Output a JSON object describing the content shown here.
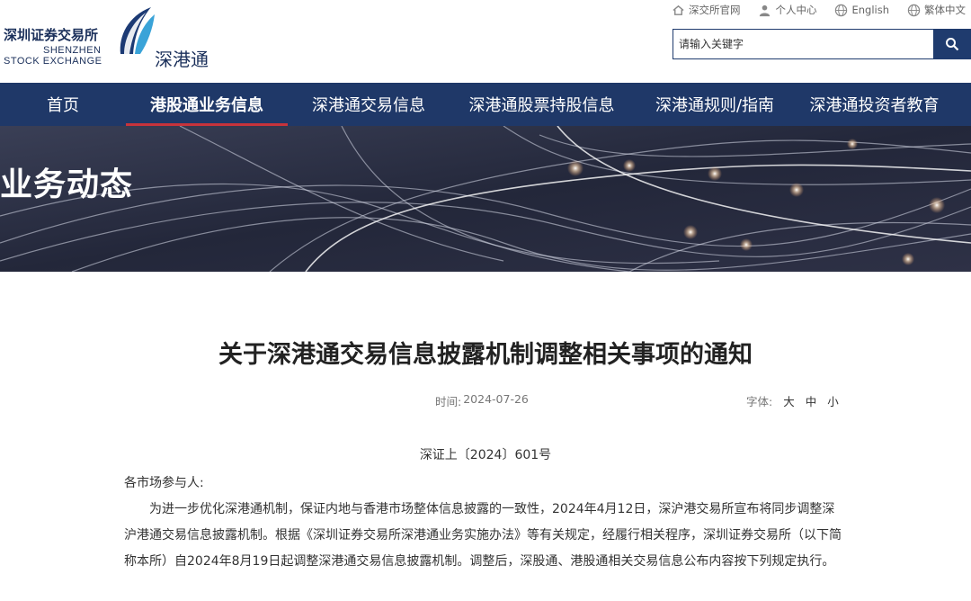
{
  "header": {
    "logo_cn": "深圳证券交易所",
    "logo_en_line1": "SHENZHEN",
    "logo_en_line2": "STOCK EXCHANGE",
    "logo_sub": "深港通",
    "top_links": [
      {
        "label": "深交所官网",
        "icon": "home-icon"
      },
      {
        "label": "个人中心",
        "icon": "user-icon"
      },
      {
        "label": "English",
        "icon": "globe-icon"
      },
      {
        "label": "繁体中文",
        "icon": "globe-icon"
      }
    ],
    "search": {
      "placeholder": "请输入关键字",
      "button_icon": "search-icon"
    }
  },
  "nav": {
    "items": [
      {
        "label": "首页",
        "active": false
      },
      {
        "label": "港股通业务信息",
        "active": true
      },
      {
        "label": "深港通交易信息",
        "active": false
      },
      {
        "label": "深港通股票持股信息",
        "active": false
      },
      {
        "label": "深港通规则/指南",
        "active": false
      },
      {
        "label": "深港通投资者教育",
        "active": false
      }
    ]
  },
  "banner": {
    "title": "业务动态"
  },
  "article": {
    "title": "关于深港通交易信息披露机制调整相关事项的通知",
    "time_label": "时间:",
    "time_value": "2024-07-26",
    "font_label": "字体:",
    "font_sizes": [
      "大",
      "中",
      "小"
    ],
    "doc_no": "深证上〔2024〕601号",
    "salutation": "各市场参与人:",
    "paragraph": "为进一步优化深港通机制，保证内地与香港市场整体信息披露的一致性，2024年4月12日，深沪港交易所宣布将同步调整深沪港通交易信息披露机制。根据《深圳证券交易所深港通业务实施办法》等有关规定，经履行相关程序，深圳证券交易所（以下简称本所）自2024年8月19日起调整深港通交易信息披露机制。调整后，深股通、港股通相关交易信息公布内容按下列规定执行。"
  },
  "colors": {
    "nav_bg": "#1f3868",
    "active_underline": "#c7333b",
    "search_btn": "#1f3b6e"
  }
}
